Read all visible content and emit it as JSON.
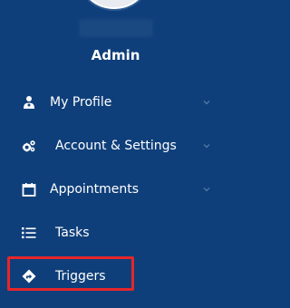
{
  "user": {
    "name": "Admin"
  },
  "menu": {
    "items": [
      {
        "label": "My Profile",
        "icon": "user-doctor-icon",
        "has_chevron": true
      },
      {
        "label": "Account & Settings",
        "icon": "gears-icon",
        "has_chevron": true
      },
      {
        "label": "Appointments",
        "icon": "calendar-icon",
        "has_chevron": true
      },
      {
        "label": "Tasks",
        "icon": "list-icon",
        "has_chevron": false
      },
      {
        "label": "Triggers",
        "icon": "diamond-arrow-icon",
        "has_chevron": false,
        "highlighted": true
      }
    ]
  },
  "colors": {
    "sidebar_bg": "#0f3f7a",
    "text": "#ffffff",
    "highlight_border": "#e5262a"
  }
}
